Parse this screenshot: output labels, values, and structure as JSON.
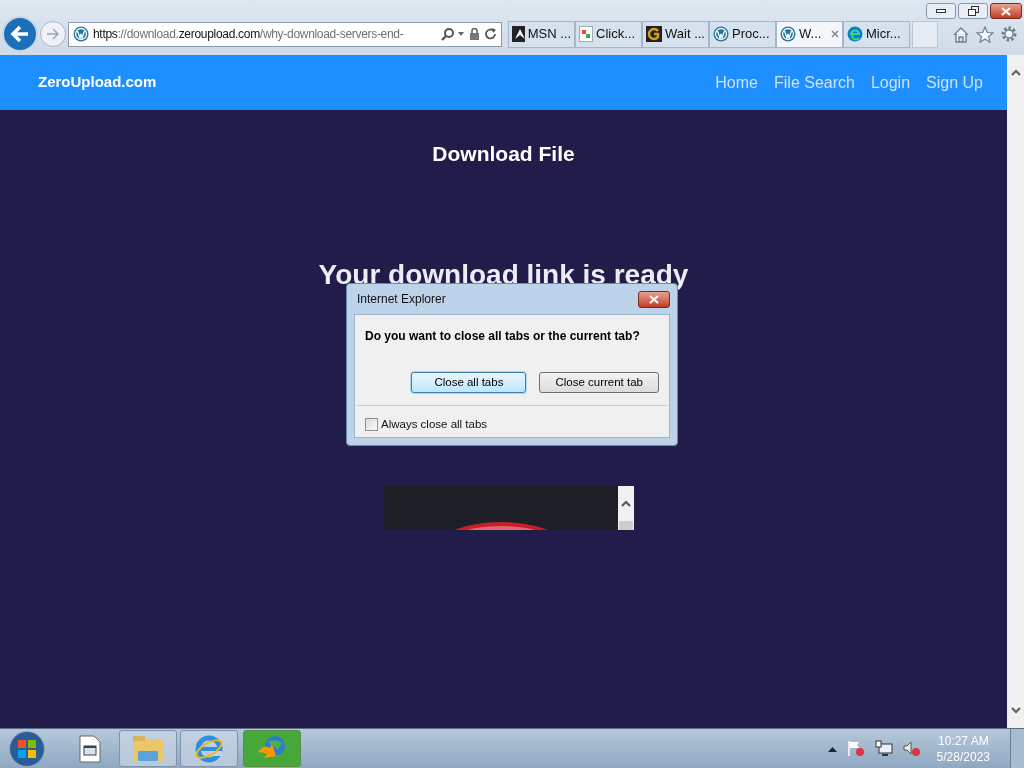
{
  "browser": {
    "url": [
      {
        "text": "https",
        "dim": false
      },
      {
        "text": "://download.",
        "dim": true
      },
      {
        "text": "zeroupload.com",
        "dim": false
      },
      {
        "text": "/why-download-servers-end-",
        "dim": true
      }
    ],
    "tabs": [
      {
        "label": "MSN ...",
        "kind": "msn",
        "selected": false
      },
      {
        "label": "Click...",
        "kind": "page",
        "selected": false
      },
      {
        "label": "Wait ...",
        "kind": "g",
        "selected": false
      },
      {
        "label": "Proc...",
        "kind": "wp",
        "selected": false
      },
      {
        "label": "W...",
        "kind": "wp",
        "selected": true
      },
      {
        "label": "Micr...",
        "kind": "edge",
        "selected": false
      }
    ]
  },
  "site": {
    "brand": "ZeroUpload.com",
    "nav": [
      "Home",
      "File Search",
      "Login",
      "Sign Up"
    ],
    "heading": "Download File",
    "headline": "Your download link is ready"
  },
  "dialog": {
    "title": "Internet Explorer",
    "message": "Do you want to close all tabs or the current tab?",
    "buttons": [
      {
        "label": "Close all tabs",
        "default": true
      },
      {
        "label": "Close current tab",
        "default": false
      }
    ],
    "checkbox": {
      "label": "Always close all tabs",
      "checked": false
    }
  },
  "taskbar": {
    "time": "10:27 AM",
    "date": "5/28/2023"
  }
}
